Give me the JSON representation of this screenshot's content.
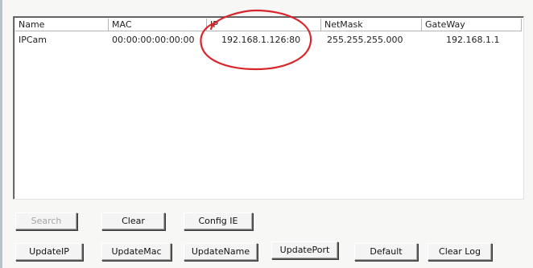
{
  "device_list": {
    "columns": [
      "Name",
      "MAC",
      "IP",
      "NetMask",
      "GateWay"
    ],
    "rows": [
      {
        "name": "IPCam",
        "mac": "00:00:00:00:00:00",
        "ip": "192.168.1.126:80",
        "netmask": "255.255.255.000",
        "gateway": "192.168.1.1"
      }
    ]
  },
  "buttons_row1": {
    "search": "Search",
    "clear": "Clear",
    "config_ie": "Config IE"
  },
  "buttons_row2": {
    "update_ip": "UpdateIP",
    "update_mac": "UpdateMac",
    "update_name": "UpdateName",
    "update_port": "UpdatePort",
    "default": "Default",
    "clear_log": "Clear Log"
  },
  "states": {
    "search_enabled": false
  },
  "colors": {
    "annotation_circle": "#d8262c",
    "window_bg": "#f7f7f6",
    "list_bg": "#ffffff"
  }
}
